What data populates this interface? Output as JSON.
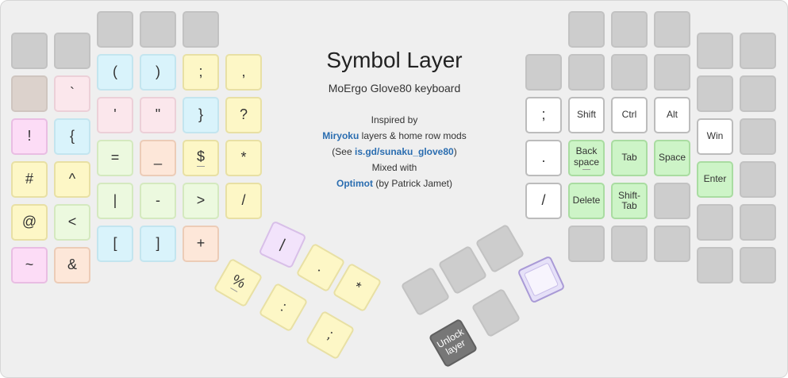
{
  "title": "Symbol Layer",
  "subtitle": "MoErgo Glove80 keyboard",
  "info": {
    "line1": "Inspired by",
    "link1": "Miryoku",
    "line2_rest": " layers & home row mods",
    "see_open": "(See ",
    "link2": "is.gd/sunaku_glove80",
    "see_close": ")",
    "line4": "Mixed with",
    "link3": "Optimot",
    "line5_rest": " (by Patrick Jamet)"
  },
  "left_keys": {
    "r3c1": "`",
    "r4c0": "!",
    "r4c1": "{",
    "r4c2": "(",
    "r4c3": ")",
    "r4c4": ";",
    "r4c5": ",",
    "r5c0": "#",
    "r5c1": "^",
    "r5c2": "'",
    "r5c3": "\"",
    "r5c4": "}",
    "r5c5": "?",
    "r6c0": "@",
    "r6c1": "<",
    "r6c2": "=",
    "r6c3": "_",
    "r6c4": "$",
    "r6c5": "*",
    "r7c0": "~",
    "r7c1": "&",
    "r7c2": "|",
    "r7c3": "-",
    "r7c4": ">",
    "r7c5": "/",
    "r8c2": "[",
    "r8c3": "]",
    "r8c4": "+"
  },
  "left_thumb": {
    "t1": "|",
    "t2": ".",
    "t3": "*",
    "t4": "%",
    "t5": ":",
    "t6": ";"
  },
  "right_keys": {
    "semicolon": ";",
    "period": ".",
    "slash": "/",
    "shift": "Shift",
    "ctrl": "Ctrl",
    "alt": "Alt",
    "win": "Win",
    "backspace": "Back space",
    "tab": "Tab",
    "space": "Space",
    "enter": "Enter",
    "delete": "Delete",
    "shift_tab": "Shift- Tab"
  },
  "right_thumb": {
    "unlock": "Unlock layer"
  },
  "colors": {
    "background": "#efefef",
    "blank_key": "#cdcdcd",
    "link": "#2a6db0",
    "mod_key": "#ffffff",
    "nav_key": "#cdf4c7"
  }
}
